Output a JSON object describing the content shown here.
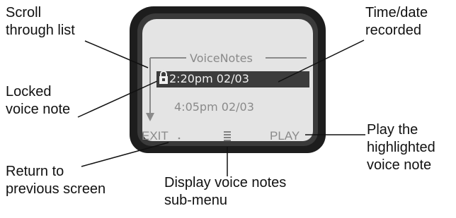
{
  "callouts": {
    "scroll": [
      "Scroll",
      "through list"
    ],
    "locked": [
      "Locked",
      "voice note"
    ],
    "return": [
      "Return to",
      "previous screen"
    ],
    "submenu": [
      "Display voice notes",
      "sub-menu"
    ],
    "time": [
      "Time/date",
      "recorded"
    ],
    "play": [
      "Play the",
      "highlighted",
      "voice note"
    ]
  },
  "screen": {
    "title": "VoiceNotes",
    "rows": [
      {
        "text": "2:20pm 02/03",
        "locked": true,
        "highlighted": true
      },
      {
        "text": "4:05pm 02/03",
        "locked": false,
        "highlighted": false
      }
    ],
    "softkeys": {
      "left": "EXIT",
      "center_icon": "menu-icon",
      "right": "PLAY"
    }
  },
  "colors": {
    "screen_bg": "#e4e4e4",
    "highlight_bg": "#3c3c3c",
    "frame": "#1d1d1d",
    "screen_text": "#8a8a8a"
  }
}
